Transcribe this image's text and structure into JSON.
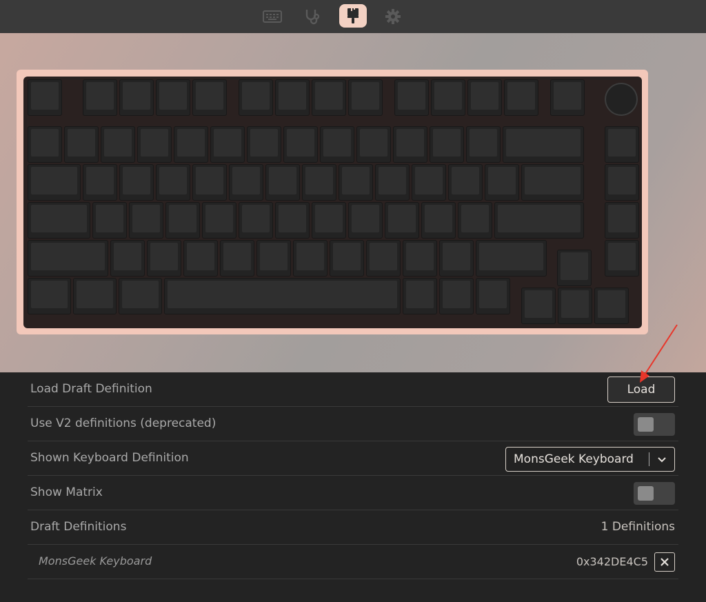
{
  "nav": {
    "items": [
      {
        "icon": "keyboard-icon"
      },
      {
        "icon": "stethoscope-icon"
      },
      {
        "icon": "paintbrush-icon",
        "active": true
      },
      {
        "icon": "gear-icon"
      }
    ],
    "active_color": "#f3d1c3"
  },
  "keyboard": {
    "case_color": "#f3c8ba"
  },
  "settings": {
    "load_draft": {
      "label": "Load Draft Definition",
      "button": "Load"
    },
    "use_v2": {
      "label": "Use V2 definitions (deprecated)",
      "enabled": false
    },
    "shown_definition": {
      "label": "Shown Keyboard Definition",
      "selected": "MonsGeek Keyboard"
    },
    "show_matrix": {
      "label": "Show Matrix",
      "enabled": false
    },
    "draft_definitions": {
      "label": "Draft Definitions",
      "count_text": "1 Definitions"
    },
    "draft_item": {
      "name": "MonsGeek Keyboard",
      "id": "0x342DE4C5"
    }
  },
  "annotation": {
    "arrow_color": "#e8362a"
  }
}
